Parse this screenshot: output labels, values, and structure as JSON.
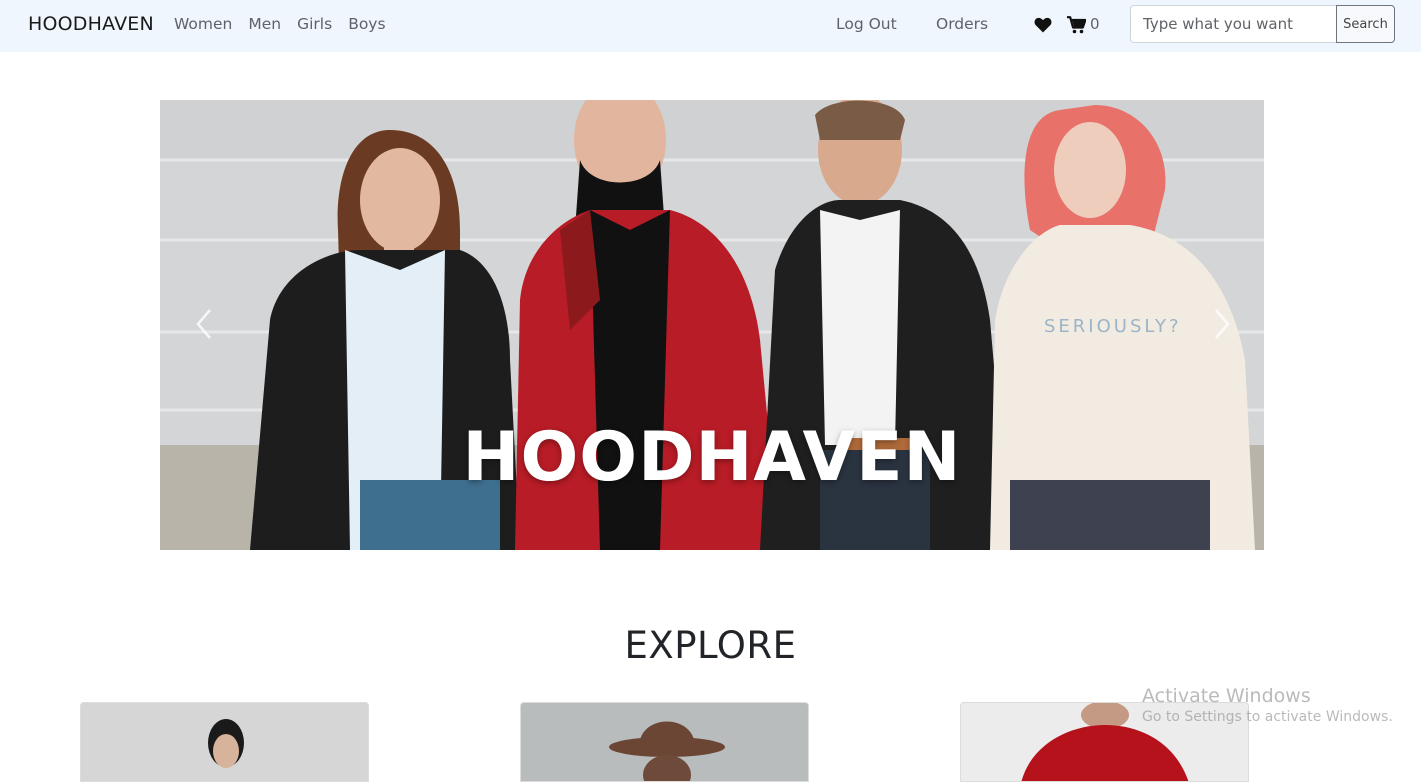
{
  "navbar": {
    "brand": "HOODHAVEN",
    "categories": [
      "Women",
      "Men",
      "Girls",
      "Boys"
    ],
    "logout_label": "Log Out",
    "orders_label": "Orders",
    "cart_count": "0",
    "search_placeholder": "Type what you want",
    "search_button": "Search",
    "icons": {
      "wishlist": "heart-icon",
      "cart": "cart-icon"
    }
  },
  "hero": {
    "title": "HOODHAVEN",
    "print_text": "SERIOUSLY?",
    "controls": {
      "prev": "chevron-left-icon",
      "next": "chevron-right-icon"
    }
  },
  "explore": {
    "heading": "EXPLORE",
    "cards": [
      {
        "name": "women-category-card"
      },
      {
        "name": "men-category-card"
      },
      {
        "name": "hoodie-category-card"
      }
    ]
  },
  "os_watermark": {
    "title": "Activate Windows",
    "subtitle": "Go to Settings to activate Windows."
  },
  "colors": {
    "navbar_bg": "#f0f6fd",
    "hero_text": "#ffffff",
    "red_jacket": "#b81c26"
  }
}
